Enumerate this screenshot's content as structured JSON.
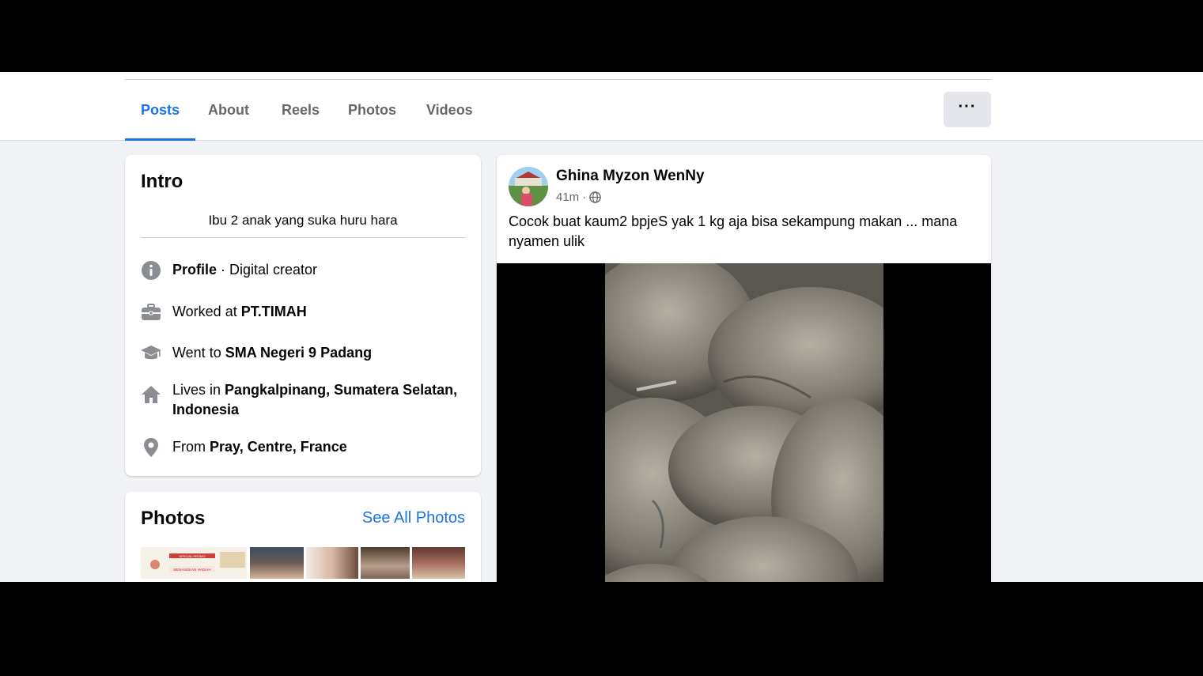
{
  "tabs": [
    {
      "label": "Posts",
      "active": true
    },
    {
      "label": "About"
    },
    {
      "label": "Reels"
    },
    {
      "label": "Photos"
    },
    {
      "label": "Videos"
    }
  ],
  "more_icon": "more-horizontal-icon",
  "more_label": "···",
  "intro": {
    "title": "Intro",
    "bio": "Ibu 2 anak yang suka huru hara",
    "rows": [
      {
        "icon": "info-icon",
        "bold": "Profile",
        "text": " · Digital creator"
      },
      {
        "icon": "briefcase-icon",
        "prefix": "Worked at ",
        "bold": "PT.TIMAH"
      },
      {
        "icon": "graduation-cap-icon",
        "prefix": "Went to ",
        "bold": "SMA Negeri 9 Padang"
      },
      {
        "icon": "home-icon",
        "prefix": "Lives in ",
        "bold": "Pangkalpinang, Sumatera Selatan, Indonesia"
      },
      {
        "icon": "location-pin-icon",
        "prefix": "From ",
        "bold": "Pray, Centre, France"
      }
    ]
  },
  "photos": {
    "title": "Photos",
    "see_all": "See All Photos",
    "thumb_text": [
      "SPECIAL PROMO",
      "MENANGKAN HADIAH"
    ]
  },
  "post": {
    "author": "Ghina Myzon WenNy",
    "time": "41m",
    "separator": "·",
    "privacy_icon": "globe-icon",
    "text": "Cocok buat kaum2 bpjeS yak 1 kg aja bisa sekampung makan ... mana nyamen ulik"
  },
  "colors": {
    "accent": "#1b74e4",
    "secondary_text": "#65676b",
    "background": "#f0f2f5"
  }
}
